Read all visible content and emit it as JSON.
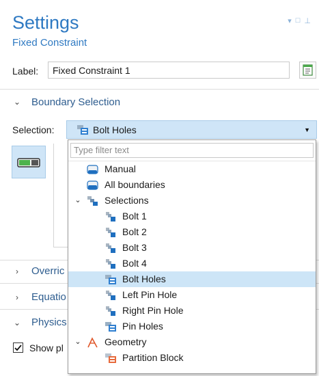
{
  "header": {
    "title": "Settings",
    "subtitle": "Fixed Constraint"
  },
  "label_row": {
    "label": "Label:",
    "value": "Fixed Constraint 1"
  },
  "sections": {
    "boundary": "Boundary Selection",
    "override": "Overric",
    "equation": "Equatio",
    "physics": "Physics"
  },
  "selection": {
    "label": "Selection:",
    "value": "Bolt Holes"
  },
  "show_checkbox": {
    "label": "Show pl",
    "checked": true
  },
  "dropdown": {
    "filter_placeholder": "Type filter text",
    "items": [
      {
        "label": "Manual",
        "icon": "manual-boundary-icon"
      },
      {
        "label": "All boundaries",
        "icon": "all-boundaries-icon"
      },
      {
        "label": "Selections",
        "icon": "selections-node-icon"
      },
      {
        "label": "Bolt 1",
        "icon": "selection-icon"
      },
      {
        "label": "Bolt 2",
        "icon": "selection-icon"
      },
      {
        "label": "Bolt 3",
        "icon": "selection-icon"
      },
      {
        "label": "Bolt 4",
        "icon": "selection-icon"
      },
      {
        "label": "Bolt Holes",
        "icon": "union-selection-icon",
        "selected": true
      },
      {
        "label": "Left Pin Hole",
        "icon": "selection-icon"
      },
      {
        "label": "Right Pin Hole",
        "icon": "selection-icon"
      },
      {
        "label": "Pin Holes",
        "icon": "union-selection-icon"
      },
      {
        "label": "Geometry",
        "icon": "geometry-icon"
      },
      {
        "label": "Partition Block",
        "icon": "partition-block-icon"
      }
    ]
  },
  "colors": {
    "accent": "#2e79c2",
    "selection_bg": "#cde5f7",
    "section_text": "#2e5d8f"
  }
}
